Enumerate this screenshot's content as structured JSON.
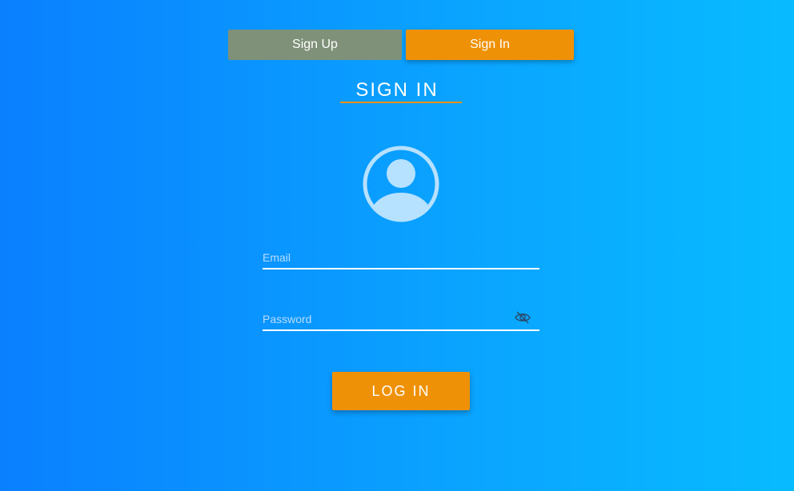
{
  "tabs": {
    "signup_label": "Sign Up",
    "signin_label": "Sign In",
    "active": "Sign In"
  },
  "heading": "SIGN IN",
  "avatar_icon": "user-circle-icon",
  "form": {
    "email": {
      "placeholder": "Email",
      "value": ""
    },
    "password": {
      "placeholder": "Password",
      "value": "",
      "toggle_icon": "eye-off-icon"
    }
  },
  "login_button_label": "LOG IN",
  "colors": {
    "accent": "#ef9107",
    "inactive_tab": "#7f9179",
    "gradient_start": "#0a80ff",
    "gradient_end": "#08bbff"
  }
}
